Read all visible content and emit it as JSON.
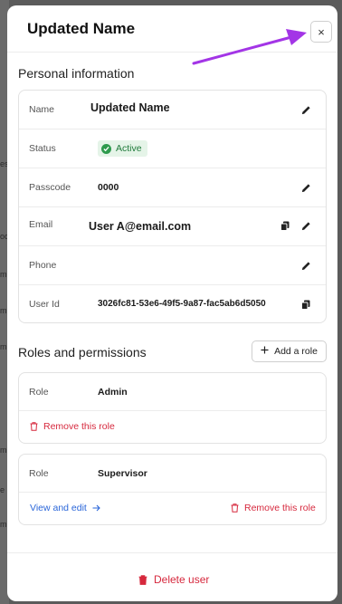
{
  "background": {
    "fragments": [
      "es",
      "oc",
      "mi",
      "mi",
      "mi",
      "mi",
      "e",
      "mi"
    ]
  },
  "modal": {
    "title": "Updated Name",
    "close_label": "×"
  },
  "personal": {
    "section_title": "Personal information",
    "rows": [
      {
        "label": "Name",
        "value": "Updated Name"
      },
      {
        "label": "Status",
        "value": "Active"
      },
      {
        "label": "Passcode",
        "value": "0000"
      },
      {
        "label": "Email",
        "value": "User A@email.com"
      },
      {
        "label": "Phone",
        "value": ""
      },
      {
        "label": "User Id",
        "value": "3026fc81-53e6-49f5-9a87-fac5ab6d5050"
      }
    ]
  },
  "roles": {
    "section_title": "Roles and permissions",
    "add_label": "Add a role",
    "cards": [
      {
        "label": "Role",
        "value": "Admin",
        "remove_label": "Remove this role"
      },
      {
        "label": "Role",
        "value": "Supervisor",
        "view_label": "View and edit",
        "remove_label": "Remove this role"
      }
    ]
  },
  "footer": {
    "delete_label": "Delete user"
  },
  "colors": {
    "accent_red": "#d6283d",
    "accent_blue": "#2a66d9",
    "status_green": "#1f7a3a",
    "annotation_arrow": "#a335e6"
  },
  "icons": [
    "close-icon",
    "pencil-icon",
    "copy-icon",
    "check-circle-icon",
    "plus-icon",
    "trash-icon",
    "arrow-right-icon"
  ]
}
